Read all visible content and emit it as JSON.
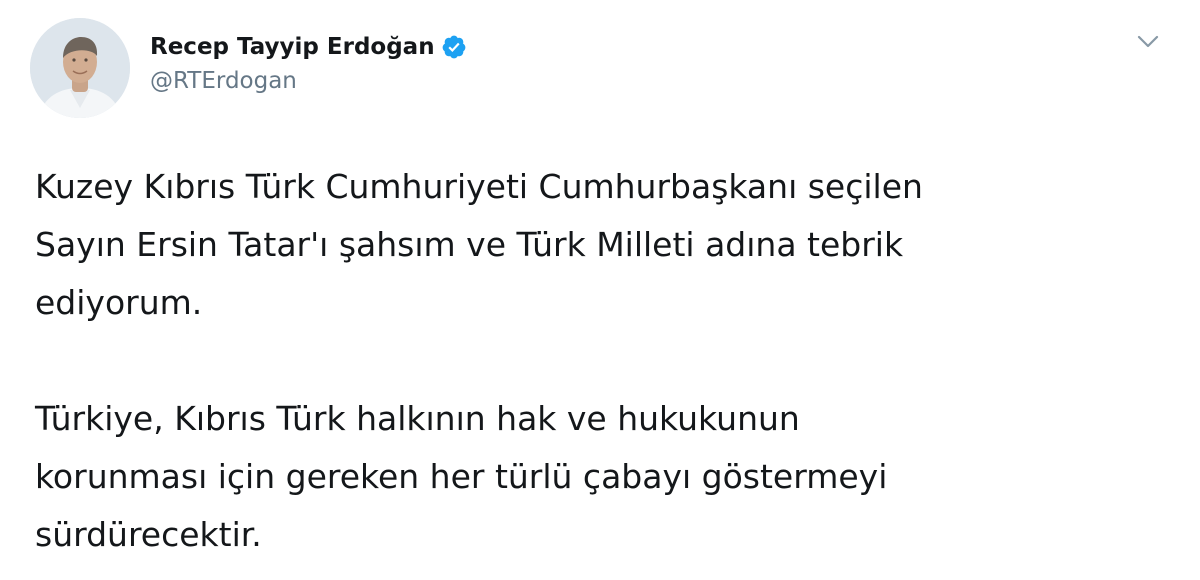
{
  "tweet": {
    "author": {
      "display_name": "Recep Tayyip Erdoğan",
      "handle": "@RTErdogan",
      "verified": true
    },
    "menu_icon": "chevron-down-icon",
    "paragraphs": [
      "Kuzey Kıbrıs Türk Cumhuriyeti Cumhurbaşkanı seçilen\nSayın Ersin Tatar'ı şahsım ve Türk Milleti adına tebrik\nediyorum.",
      "Türkiye, Kıbrıs Türk halkının hak ve hukukunun\nkorunması için gereken her türlü çabayı göstermeyi\nsürdürecektir."
    ]
  },
  "colors": {
    "text": "#14171a",
    "secondary": "#657786",
    "verified": "#1da1f2"
  }
}
